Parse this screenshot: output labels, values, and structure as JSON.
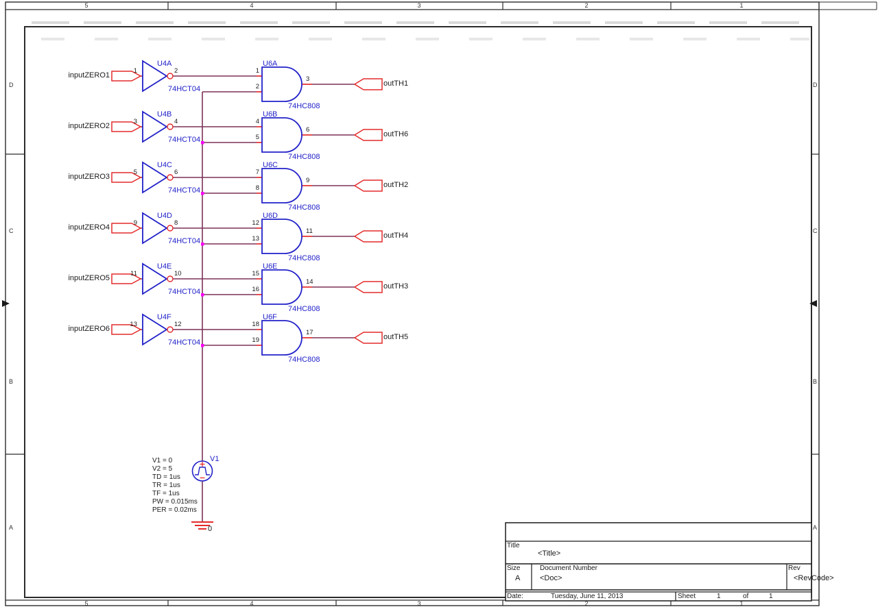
{
  "app": {
    "description": "Schematic capture page with six inverter/AND-gate channels, a pulse source and title block"
  },
  "colors": {
    "symbol_blue": "#2121c9",
    "pin_red": "#e42a2a",
    "wire_maroon": "#7b3159",
    "junction_magenta": "#ff00ff"
  },
  "frame": {
    "cols": [
      "5",
      "4",
      "3",
      "2",
      "1"
    ],
    "rows": [
      "D",
      "C",
      "B",
      "A"
    ]
  },
  "rows": [
    {
      "input_label": "inputZERO1",
      "input_pin": "1",
      "inverter": {
        "ref": "U4A",
        "part": "74HCT04",
        "out_pin": "2"
      },
      "gate": {
        "ref": "U6A",
        "part": "74HC808",
        "in_pin1": "1",
        "in_pin2": "2",
        "out_pin": "3"
      },
      "output_label": "outTH1"
    },
    {
      "input_label": "inputZERO2",
      "input_pin": "3",
      "inverter": {
        "ref": "U4B",
        "part": "74HCT04",
        "out_pin": "4"
      },
      "gate": {
        "ref": "U6B",
        "part": "74HC808",
        "in_pin1": "4",
        "in_pin2": "5",
        "out_pin": "6"
      },
      "output_label": "outTH6"
    },
    {
      "input_label": "inputZERO3",
      "input_pin": "5",
      "inverter": {
        "ref": "U4C",
        "part": "74HCT04",
        "out_pin": "6"
      },
      "gate": {
        "ref": "U6C",
        "part": "74HC808",
        "in_pin1": "7",
        "in_pin2": "8",
        "out_pin": "9"
      },
      "output_label": "outTH2"
    },
    {
      "input_label": "inputZERO4",
      "input_pin": "9",
      "inverter": {
        "ref": "U4D",
        "part": "74HCT04",
        "out_pin": "8"
      },
      "gate": {
        "ref": "U6D",
        "part": "74HC808",
        "in_pin1": "12",
        "in_pin2": "13",
        "out_pin": "11"
      },
      "output_label": "outTH4"
    },
    {
      "input_label": "inputZERO5",
      "input_pin": "11",
      "inverter": {
        "ref": "U4E",
        "part": "74HCT04",
        "out_pin": "10"
      },
      "gate": {
        "ref": "U6E",
        "part": "74HC808",
        "in_pin1": "15",
        "in_pin2": "16",
        "out_pin": "14"
      },
      "output_label": "outTH3"
    },
    {
      "input_label": "inputZERO6",
      "input_pin": "13",
      "inverter": {
        "ref": "U4F",
        "part": "74HCT04",
        "out_pin": "12"
      },
      "gate": {
        "ref": "U6F",
        "part": "74HC808",
        "in_pin1": "18",
        "in_pin2": "19",
        "out_pin": "17"
      },
      "output_label": "outTH5"
    }
  ],
  "source": {
    "ref": "V1",
    "params": [
      "V1 = 0",
      "V2 = 5",
      "TD = 1us",
      "TR = 1us",
      "TF = 1us",
      "PW = 0.015ms",
      "PER = 0.02ms"
    ],
    "ground_label": "0"
  },
  "title_block": {
    "title_label": "Title",
    "title_value": "<Title>",
    "size_label": "Size",
    "size_value": "A",
    "doc_label": "Document Number",
    "doc_value": "<Doc>",
    "rev_label": "Rev",
    "rev_value": "<RevCode>",
    "date_label": "Date:",
    "date_value": "Tuesday, June 11, 2013",
    "sheet_label": "Sheet",
    "sheet_number": "1",
    "of_label": "of",
    "sheet_total": "1"
  }
}
